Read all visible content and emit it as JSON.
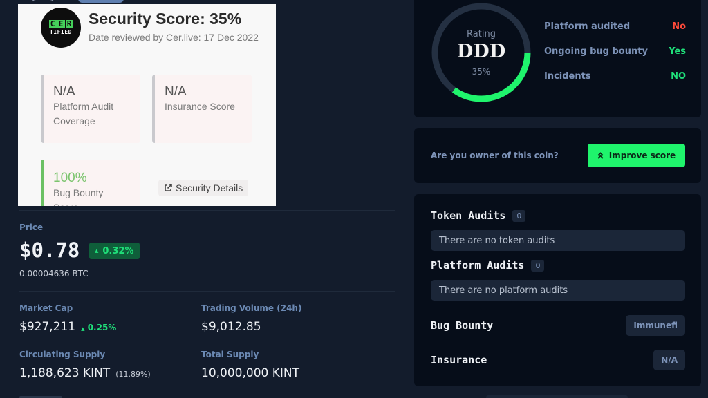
{
  "security_card": {
    "logo_top": [
      "C",
      "E",
      "R"
    ],
    "logo_bottom": "TIFIED",
    "title": "Security Score: 35%",
    "date_reviewed": "Date reviewed by Cer.live: 17 Dec 2022",
    "metrics": [
      {
        "value": "N/A",
        "label": "Platform Audit Coverage"
      },
      {
        "value": "N/A",
        "label": "Insurance Score"
      },
      {
        "value": "100%",
        "label": "Bug Bounty Score"
      }
    ],
    "details_button": "Security Details"
  },
  "price": {
    "label": "Price",
    "value": "$0.78",
    "change": "0.32%",
    "change_direction": "up",
    "btc": "0.00004636 BTC"
  },
  "stats": {
    "market_cap": {
      "label": "Market Cap",
      "value": "$927,211",
      "change": "0.25%"
    },
    "trading_volume": {
      "label": "Trading Volume (24h)",
      "value": "$9,012.85"
    },
    "circulating_supply": {
      "label": "Circulating Supply",
      "value": "1,188,623 KINT",
      "percent": "(11.89%)"
    },
    "total_supply": {
      "label": "Total Supply",
      "value": "10,000,000 KINT"
    }
  },
  "rating": {
    "label": "Rating",
    "grade": "DDD",
    "percent_text": "35%",
    "progress": 0.35,
    "criteria": [
      {
        "label": "Platform audited",
        "value": "No",
        "status": "bad"
      },
      {
        "label": "Ongoing bug bounty",
        "value": "Yes",
        "status": "good"
      },
      {
        "label": "Incidents",
        "value": "NO",
        "status": "good"
      }
    ]
  },
  "owner": {
    "question": "Are you owner of this coin?",
    "button": "Improve score"
  },
  "audits": {
    "token": {
      "title": "Token Audits",
      "count": "0",
      "empty": "There are no token audits"
    },
    "platform": {
      "title": "Platform Audits",
      "count": "0",
      "empty": "There are no platform audits"
    },
    "bug_bounty": {
      "label": "Bug Bounty",
      "value": "Immunefi"
    },
    "insurance": {
      "label": "Insurance",
      "value": "N/A"
    }
  },
  "colors": {
    "accent_green": "#1ff46c",
    "negative_red": "#ff4a3a",
    "ring_track": "#243042"
  }
}
